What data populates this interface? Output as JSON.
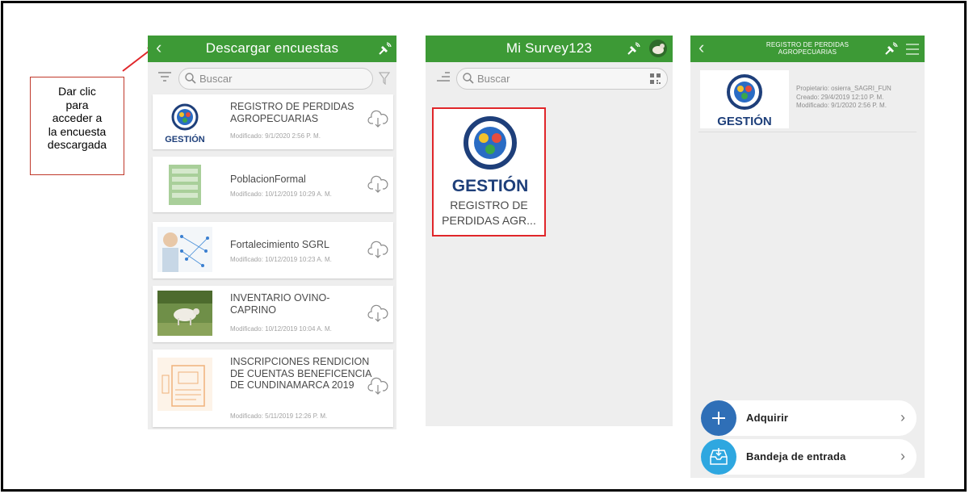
{
  "annotation": {
    "lines": [
      "Dar clic",
      "para",
      "acceder a",
      "la encuesta",
      "descargada"
    ]
  },
  "download_panel": {
    "title": "Descargar encuestas",
    "back_icon": "chevron-left-icon",
    "search_placeholder": "Buscar",
    "surveys": [
      {
        "name": "REGISTRO DE PERDIDAS AGROPECUARIAS",
        "modified": "Modificado: 9/1/2020 2:56 P. M.",
        "thumb": "gestion-logo"
      },
      {
        "name": "PoblacionFormal",
        "modified": "Modificado: 10/12/2019 10:29 A. M.",
        "thumb": "green-list"
      },
      {
        "name": "Fortalecimiento SGRL",
        "modified": "Modificado: 10/12/2019 10:23 A. M.",
        "thumb": "network-person"
      },
      {
        "name": "INVENTARIO OVINO-CAPRINO",
        "modified": "Modificado: 10/12/2019 10:04 A. M.",
        "thumb": "sheep-photo"
      },
      {
        "name": "INSCRIPCIONES RENDICION DE CUENTAS BENEFICENCIA DE CUNDINAMARCA  2019",
        "modified": "Modificado: 5/11/2019 12:26 P. M.",
        "thumb": "clipboard-illustration"
      }
    ]
  },
  "mysurvey_panel": {
    "title": "Mi Survey123",
    "search_placeholder": "Buscar",
    "tile": {
      "logo_text": "GESTIÓN",
      "name": "REGISTRO DE PERDIDAS AGR..."
    }
  },
  "detail_panel": {
    "title": "REGISTRO DE PERDIDAS AGROPECUARIAS",
    "logo_text": "GESTIÓN",
    "owner": "Propietario: osierra_SAGRI_FUN",
    "created": "Creado: 29/4/2019 12:10 P. M.",
    "modified": "Modificado: 9/1/2020 2:56 P. M.",
    "actions": [
      {
        "label": "Adquirir",
        "icon": "plus-icon",
        "color": "#2f6fb7"
      },
      {
        "label": "Bandeja de entrada",
        "icon": "inbox-icon",
        "color": "#2ea7e0"
      }
    ]
  },
  "colors": {
    "header_green": "#3d9a36",
    "highlight_red": "#e0262a"
  }
}
